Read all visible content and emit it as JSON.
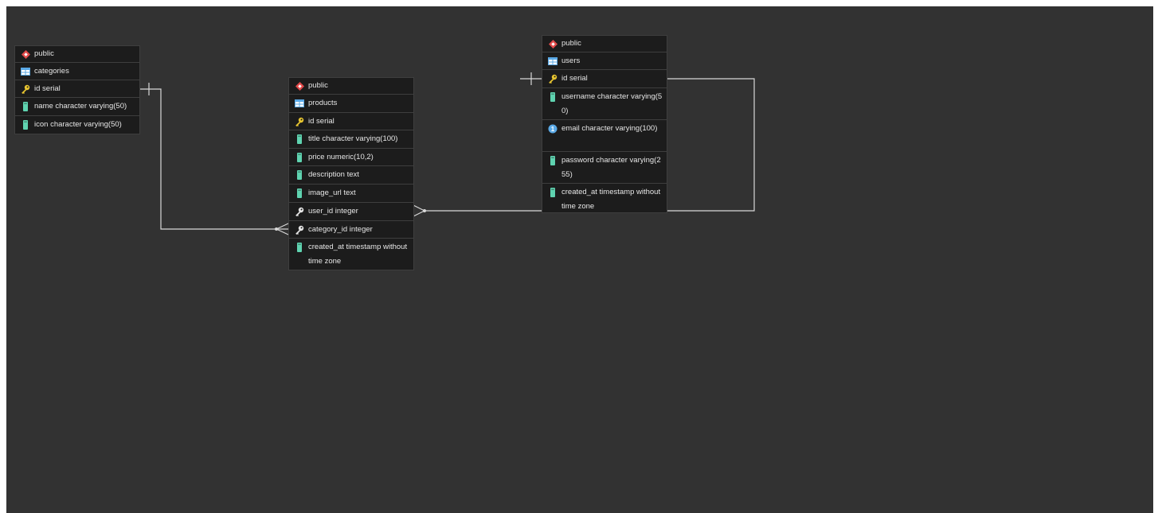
{
  "tables": [
    {
      "id": "categories",
      "schema": "public",
      "name": "categories",
      "columns": [
        {
          "icon": "primary-key-icon",
          "text": "id serial"
        },
        {
          "icon": "column-icon",
          "text": "name character varying(50)"
        },
        {
          "icon": "column-icon",
          "text": "icon character varying(50)"
        }
      ]
    },
    {
      "id": "products",
      "schema": "public",
      "name": "products",
      "columns": [
        {
          "icon": "primary-key-icon",
          "text": "id serial"
        },
        {
          "icon": "column-icon",
          "text": "title character varying(100)"
        },
        {
          "icon": "column-icon",
          "text": "price numeric(10,2)"
        },
        {
          "icon": "column-icon",
          "text": "description text"
        },
        {
          "icon": "column-icon",
          "text": "image_url text"
        },
        {
          "icon": "foreign-key-icon",
          "text": "user_id integer"
        },
        {
          "icon": "foreign-key-icon",
          "text": "category_id integer"
        },
        {
          "icon": "column-icon",
          "text": "created_at timestamp without time zone"
        }
      ]
    },
    {
      "id": "users",
      "schema": "public",
      "name": "users",
      "columns": [
        {
          "icon": "primary-key-icon",
          "text": "id serial"
        },
        {
          "icon": "column-icon",
          "text": "username character varying(50)"
        },
        {
          "icon": "unique-icon",
          "text": "email character varying(100)"
        },
        {
          "icon": "column-icon",
          "text": "password character varying(255)"
        },
        {
          "icon": "column-icon",
          "text": "created_at timestamp without time zone"
        }
      ]
    }
  ],
  "relations": [
    {
      "from": "categories.id",
      "to": "products.category_id",
      "cardinality": "one-to-many"
    },
    {
      "from": "users.id",
      "to": "products.user_id",
      "cardinality": "one-to-many"
    }
  ],
  "colors": {
    "canvas": "#323232",
    "table": "#1c1c1c",
    "key": "#e9c630",
    "column": "#5fd3b0",
    "table_icon": "#5aa9e6",
    "schema_icon": "#e24a4a",
    "link": "#d8d8d8"
  }
}
